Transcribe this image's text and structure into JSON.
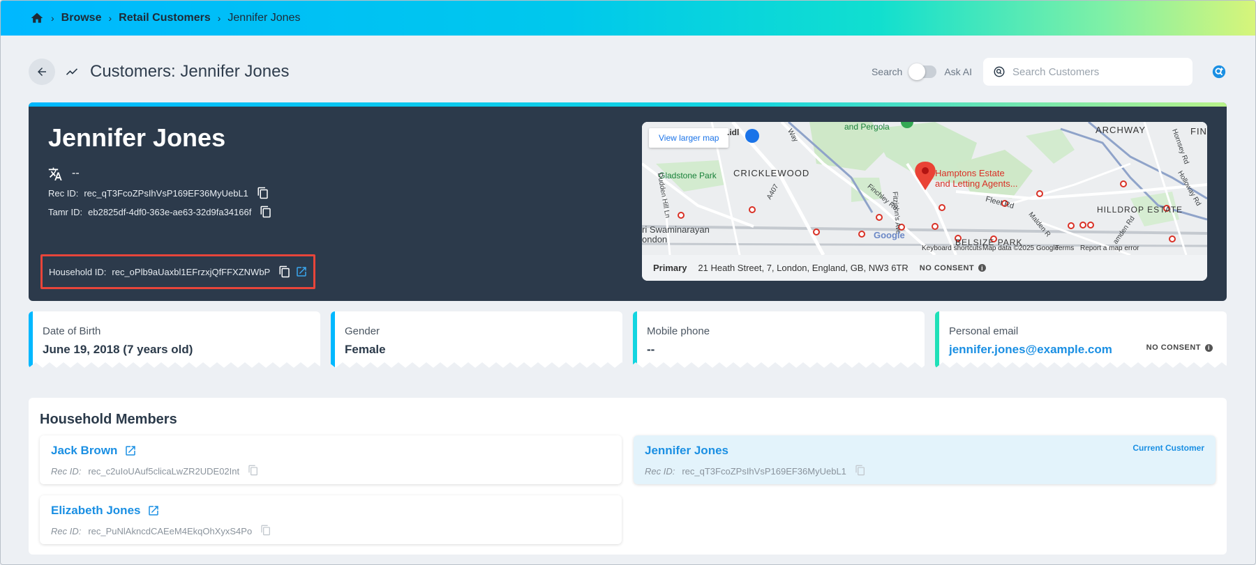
{
  "breadcrumb": {
    "home_icon": "home-icon",
    "items": [
      "Browse",
      "Retail Customers",
      "Jennifer Jones"
    ]
  },
  "header": {
    "title": "Customers: Jennifer Jones",
    "toggle_left": "Search",
    "toggle_right": "Ask AI",
    "search_placeholder": "Search Customers"
  },
  "hero": {
    "name": "Jennifer Jones",
    "language": "--",
    "rec_id_label": "Rec ID:",
    "rec_id": "rec_qT3FcoZPsIhVsP169EF36MyUebL1",
    "tamr_id_label": "Tamr ID:",
    "tamr_id": "eb2825df-4df0-363e-ae63-32d9fa34166f",
    "household_id_label": "Household ID:",
    "household_id": "rec_oPlb9aUaxbl1EFrzxjQfFFXZNWbP"
  },
  "map": {
    "view_larger": "View larger map",
    "labels": {
      "pergola": "and Pergola",
      "archway": "ARCHWAY",
      "fin": "FIN",
      "gladstone": "Gladstone Park",
      "cricklewood": "CRICKLEWOOD",
      "hamptons": "Hamptons Estate",
      "letting": "and Letting Agents...",
      "hilldrop": "HILLDROP ESTATE",
      "belsize": "BELSIZE PARK",
      "swaminarayan": "ri Swaminarayan",
      "london": "ondon",
      "fleet": "Fleet Rd",
      "a407": "A407",
      "finchley": "Finchley Rd",
      "dudden": "Dudden Hill Ln",
      "hornsey": "Hornsey Rd",
      "holloway": "Holloway Rd",
      "malden": "Malden R",
      "camden": "amden Rd",
      "fitzjohns": "Fitzjohn's Ave",
      "way": "Way",
      "idl": ".idl"
    },
    "google": "Google",
    "footer": [
      "Keyboard shortcuts",
      "Map data ©2025 Google",
      "Terms",
      "Report a map error"
    ],
    "address_type": "Primary",
    "address": "21 Heath Street, 7, London, England, GB, NW3 6TR",
    "consent": "NO CONSENT"
  },
  "attributes": [
    {
      "label": "Date of Birth",
      "value": "June 19, 2018 (7 years old)"
    },
    {
      "label": "Gender",
      "value": "Female"
    },
    {
      "label": "Mobile phone",
      "value": "--"
    },
    {
      "label": "Personal email",
      "value": "jennifer.jones@example.com",
      "consent": "NO CONSENT"
    }
  ],
  "household": {
    "title": "Household Members",
    "rec_label": "Rec ID:",
    "current_tag": "Current Customer",
    "members": [
      {
        "name": "Jack Brown",
        "rec_id": "rec_c2uIoUAuf5clicaLwZR2UDE02Int"
      },
      {
        "name": "Jennifer Jones",
        "rec_id": "rec_qT3FcoZPsIhVsP169EF36MyUebL1"
      },
      {
        "name": "Elizabeth Jones",
        "rec_id": "rec_PuNlAkncdCAEeM4EkqOhXyxS4Po"
      }
    ]
  },
  "colors": {
    "accent_blue": "#1a8fe3",
    "hero_bg": "#2c3a4b",
    "highlight_red": "#e8453a"
  }
}
